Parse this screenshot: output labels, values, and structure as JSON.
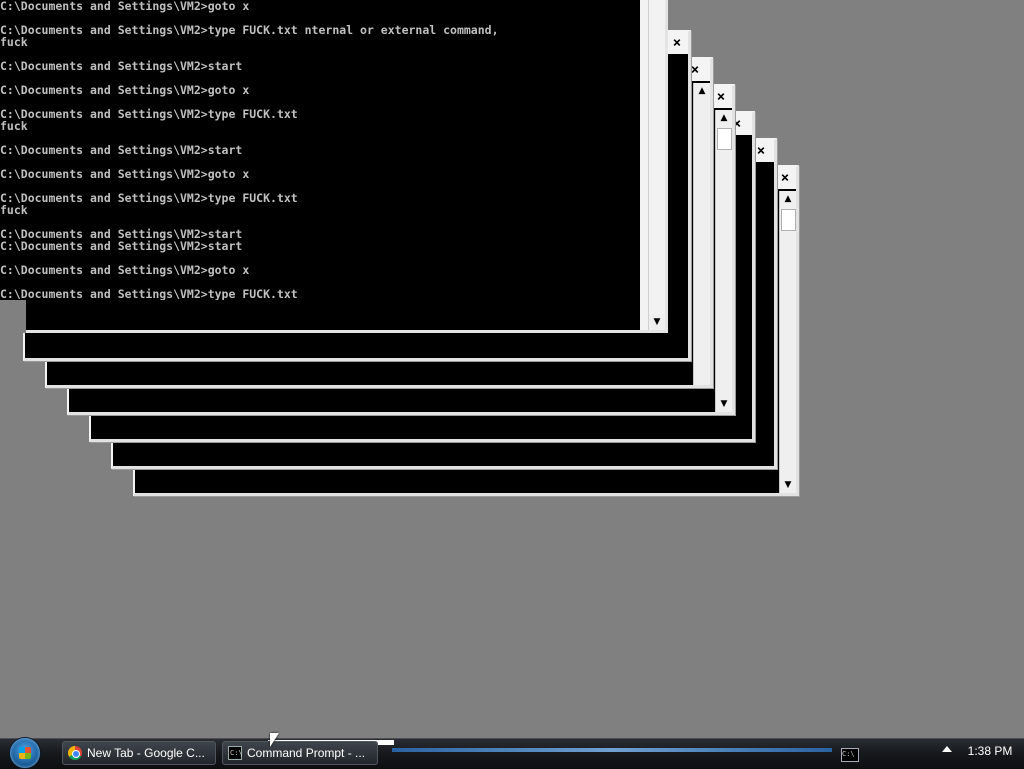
{
  "console": {
    "lines": [
      "C:\\Documents and Settings\\VM2>goto x",
      "",
      "C:\\Documents and Settings\\VM2>type FUCK.txt nternal or external command,",
      "fuck",
      "",
      "C:\\Documents and Settings\\VM2>start",
      "",
      "C:\\Documents and Settings\\VM2>goto x",
      "",
      "C:\\Documents and Settings\\VM2>type FUCK.txt",
      "fuck",
      "",
      "C:\\Documents and Settings\\VM2>start",
      "",
      "C:\\Documents and Settings\\VM2>goto x",
      "",
      "C:\\Documents and Settings\\VM2>type FUCK.txt",
      "fuck",
      "",
      "C:\\Documents and Settings\\VM2>start",
      "C:\\Documents and Settings\\VM2>start",
      "",
      "C:\\Documents and Settings\\VM2>goto x",
      "",
      "C:\\Documents and Settings\\VM2>type FUCK.txt"
    ]
  },
  "window_controls": {
    "close_glyph": "×",
    "scroll_up_glyph": "▲",
    "scroll_down_glyph": "▼"
  },
  "taskbar": {
    "buttons": [
      {
        "label": "New Tab - Google C...",
        "icon": "chrome-icon"
      },
      {
        "label": "Command Prompt - ...",
        "icon": "cmd-icon"
      }
    ],
    "cmd_icon_text": "C:\\",
    "clock": "1:38 PM"
  },
  "colors": {
    "desktop": "#808080",
    "console_bg": "#000000",
    "console_text": "#c0c0c0",
    "frame": "#f4f4f4"
  }
}
